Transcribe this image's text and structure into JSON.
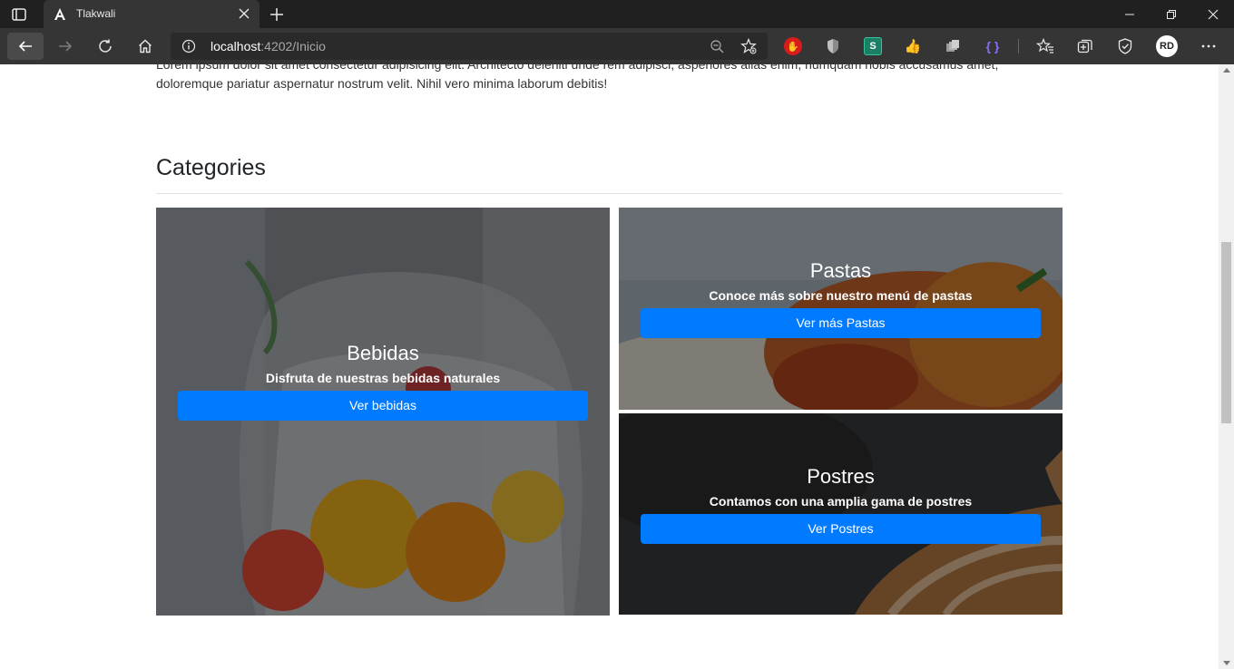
{
  "browser": {
    "tab_title": "Tlakwali",
    "url_host": "localhost",
    "url_rest": ":4202/Inicio",
    "profile_initials": "RD",
    "extensions": [
      "adblock-icon",
      "shield-extension-icon",
      "s-extension-icon",
      "thumb-extension-icon",
      "stack-extension-icon",
      "braces-extension-icon"
    ]
  },
  "page": {
    "intro_text": "Lorem ipsum dolor sit amet consectetur adipisicing elit. Architecto deleniti unde rem adipisci, asperiores alias enim, numquam nobis accusamus amet, doloremque pariatur aspernatur nostrum velit. Nihil vero minima laborum debitis!",
    "categories_heading": "Categories",
    "cards": {
      "bebidas": {
        "title": "Bebidas",
        "subtitle": "Disfruta de nuestras bebidas naturales",
        "button": "Ver bebidas"
      },
      "pastas": {
        "title": "Pastas",
        "subtitle": "Conoce más sobre nuestro menú de pastas",
        "button": "Ver más Pastas"
      },
      "postres": {
        "title": "Postres",
        "subtitle": "Contamos con una amplia gama de postres",
        "button": "Ver Postres"
      }
    }
  },
  "colors": {
    "button_primary": "#007bff",
    "chrome_dark": "#202020",
    "chrome_toolbar": "#353535"
  }
}
